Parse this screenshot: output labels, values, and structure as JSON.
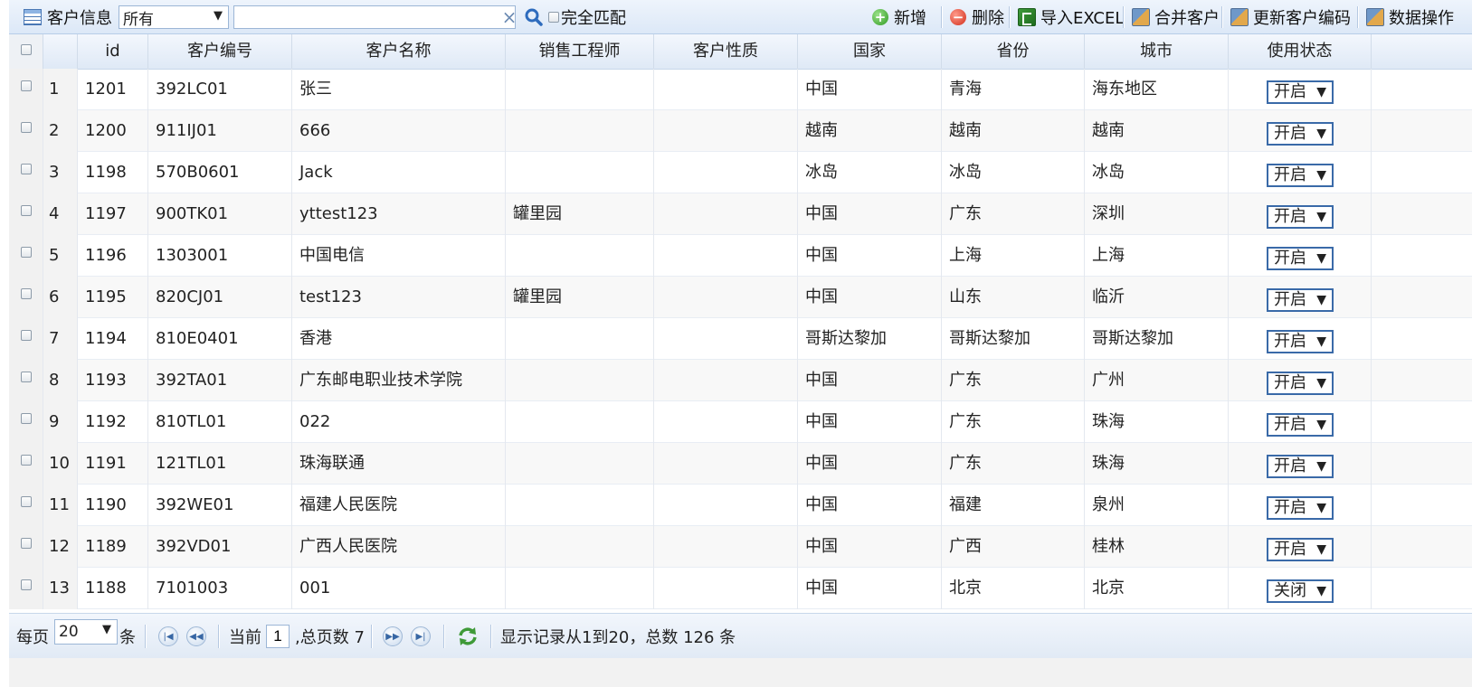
{
  "toolbar": {
    "title": "客户信息",
    "filter_select": "所有",
    "search_placeholder": "",
    "clear_symbol": "×",
    "exact_match_label": "完全匹配",
    "actions": {
      "add": "新增",
      "delete": "删除",
      "import_excel": "导入EXCEL",
      "merge": "合并客户",
      "update_code": "更新客户编码",
      "data_ops": "数据操作"
    }
  },
  "table": {
    "columns": [
      "id",
      "客户编号",
      "客户名称",
      "销售工程师",
      "客户性质",
      "国家",
      "省份",
      "城市",
      "使用状态"
    ],
    "rows": [
      {
        "n": "1",
        "id": "1201",
        "code": "392LC01",
        "name": "张三",
        "engineer": "",
        "nature": "",
        "country": "中国",
        "province": "青海",
        "city": "海东地区",
        "status": "开启"
      },
      {
        "n": "2",
        "id": "1200",
        "code": "911IJ01",
        "name": "666",
        "engineer": "",
        "nature": "",
        "country": "越南",
        "province": "越南",
        "city": "越南",
        "status": "开启"
      },
      {
        "n": "3",
        "id": "1198",
        "code": "570B0601",
        "name": "Jack",
        "engineer": "",
        "nature": "",
        "country": "冰岛",
        "province": "冰岛",
        "city": "冰岛",
        "status": "开启"
      },
      {
        "n": "4",
        "id": "1197",
        "code": "900TK01",
        "name": "yttest123",
        "engineer": "罐里园",
        "nature": "",
        "country": "中国",
        "province": "广东",
        "city": "深圳",
        "status": "开启"
      },
      {
        "n": "5",
        "id": "1196",
        "code": "1303001",
        "name": "中国电信",
        "engineer": "",
        "nature": "",
        "country": "中国",
        "province": "上海",
        "city": "上海",
        "status": "开启"
      },
      {
        "n": "6",
        "id": "1195",
        "code": "820CJ01",
        "name": "test123",
        "engineer": "罐里园",
        "nature": "",
        "country": "中国",
        "province": "山东",
        "city": "临沂",
        "status": "开启"
      },
      {
        "n": "7",
        "id": "1194",
        "code": "810E0401",
        "name": "香港",
        "engineer": "",
        "nature": "",
        "country": "哥斯达黎加",
        "province": "哥斯达黎加",
        "city": "哥斯达黎加",
        "status": "开启"
      },
      {
        "n": "8",
        "id": "1193",
        "code": "392TA01",
        "name": "广东邮电职业技术学院",
        "engineer": "",
        "nature": "",
        "country": "中国",
        "province": "广东",
        "city": "广州",
        "status": "开启"
      },
      {
        "n": "9",
        "id": "1192",
        "code": "810TL01",
        "name": "022",
        "engineer": "",
        "nature": "",
        "country": "中国",
        "province": "广东",
        "city": "珠海",
        "status": "开启"
      },
      {
        "n": "10",
        "id": "1191",
        "code": "121TL01",
        "name": "珠海联通",
        "engineer": "",
        "nature": "",
        "country": "中国",
        "province": "广东",
        "city": "珠海",
        "status": "开启"
      },
      {
        "n": "11",
        "id": "1190",
        "code": "392WE01",
        "name": "福建人民医院",
        "engineer": "",
        "nature": "",
        "country": "中国",
        "province": "福建",
        "city": "泉州",
        "status": "开启"
      },
      {
        "n": "12",
        "id": "1189",
        "code": "392VD01",
        "name": "广西人民医院",
        "engineer": "",
        "nature": "",
        "country": "中国",
        "province": "广西",
        "city": "桂林",
        "status": "开启"
      },
      {
        "n": "13",
        "id": "1188",
        "code": "7101003",
        "name": "001",
        "engineer": "",
        "nature": "",
        "country": "中国",
        "province": "北京",
        "city": "北京",
        "status": "关闭"
      }
    ]
  },
  "pager": {
    "per_page_label": "每页",
    "per_page_value": "20",
    "per_page_unit": "条",
    "current_label": "当前",
    "current_page": "1",
    "total_pages_text": ",总页数 7",
    "summary": "显示记录从1到20，总数 126 条"
  },
  "colors": {
    "toolbar_bg": "#dce8f7",
    "header_bg": "#dfe9f6",
    "row_alt": "#f8f8f8",
    "select_border": "#3a6aa8"
  }
}
